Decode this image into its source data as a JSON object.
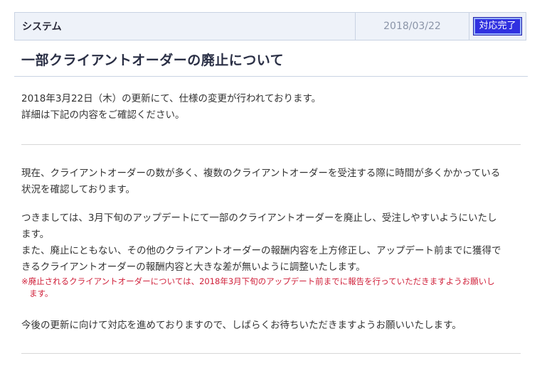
{
  "header": {
    "category": "システム",
    "date": "2018/03/22",
    "status_label": "対応完了"
  },
  "article": {
    "title": "一部クライアントオーダーの廃止について",
    "intro": [
      "2018年3月22日（木）の更新にて、仕様の変更が行われております。",
      "詳細は下記の内容をご確認ください。"
    ],
    "body1": [
      "現在、クライアントオーダーの数が多く、複数のクライアントオーダーを受注する際に時間が多くかかっている",
      "状況を確認しております。"
    ],
    "body2": [
      "つきましては、3月下旬のアップデートにて一部のクライアントオーダーを廃止し、受注しやすいようにいたし",
      "ます。",
      "また、廃止にともない、その他のクライアントオーダーの報酬内容を上方修正し、アップデート前までに獲得で",
      "きるクライアントオーダーの報酬内容と大きな差が無いように調整いたします。"
    ],
    "note": [
      "※廃止されるクライアントオーダーについては、2018年3月下旬のアップデート前までに報告を行っていただきますようお願いし",
      "ます。"
    ],
    "closing": "今後の更新に向けて対応を進めておりますので、しばらくお待ちいただきますようお願いいたします。"
  },
  "colors": {
    "status_badge_bg": "#3030e0",
    "note_text": "#d0203a",
    "header_bg": "#eef2f9"
  }
}
